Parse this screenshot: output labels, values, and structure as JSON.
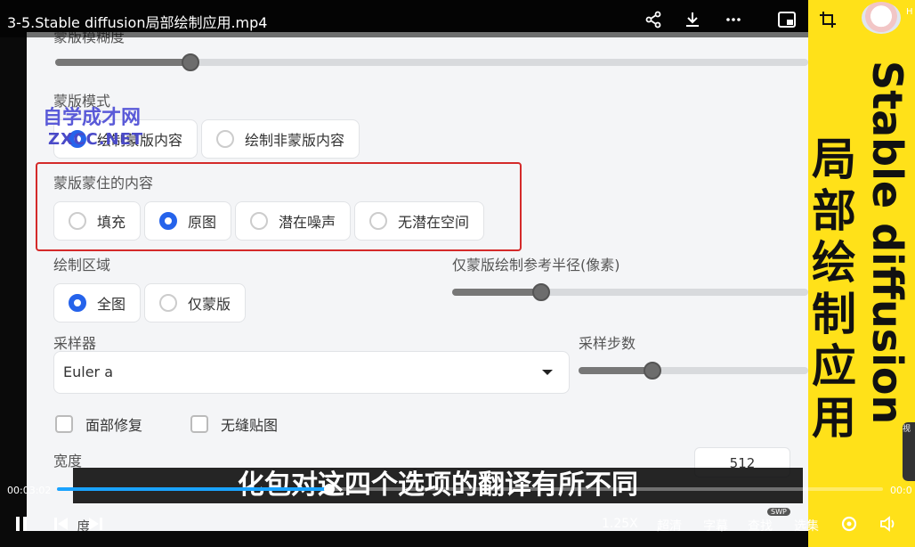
{
  "player": {
    "title": "3-5.Stable diffusion局部绘制应用.mp4",
    "avatar_text": "H",
    "current_time": "00:03:02",
    "end_time": "00:0",
    "progress": 0.33,
    "subtitle": "化包对这四个选项的翻译有所不同",
    "speed": "1.25X",
    "quality": "超清",
    "captions": "字幕",
    "search": "查找",
    "search_badge": "SWP",
    "episodes": "选集",
    "side_tab": "视"
  },
  "banner": {
    "english": "Stable diffusion",
    "chinese": "局部绘制应用"
  },
  "watermark": {
    "line1": "自学成才网",
    "line2": "ZXCC.NET"
  },
  "app": {
    "mask_blur_label": "蒙版模糊度",
    "mask_blur_value": 0.18,
    "mask_mode_label": "蒙版模式",
    "mask_mode_options": [
      "绘制蒙版内容",
      "绘制非蒙版内容"
    ],
    "masked_content_label": "蒙版蒙住的内容",
    "masked_content_options": [
      "填充",
      "原图",
      "潜在噪声",
      "无潜在空间"
    ],
    "inpaint_area_label": "绘制区域",
    "inpaint_area_options": [
      "全图",
      "仅蒙版"
    ],
    "padding_label": "仅蒙版绘制参考半径(像素)",
    "padding_value": 0.25,
    "sampler_label": "采样器",
    "sampler_value": "Euler a",
    "steps_label": "采样步数",
    "steps_value": 0.32,
    "restore_faces": "面部修复",
    "tiling": "无缝贴图",
    "width_label": "宽度",
    "width_value": "512",
    "height_label_partial": "度"
  }
}
